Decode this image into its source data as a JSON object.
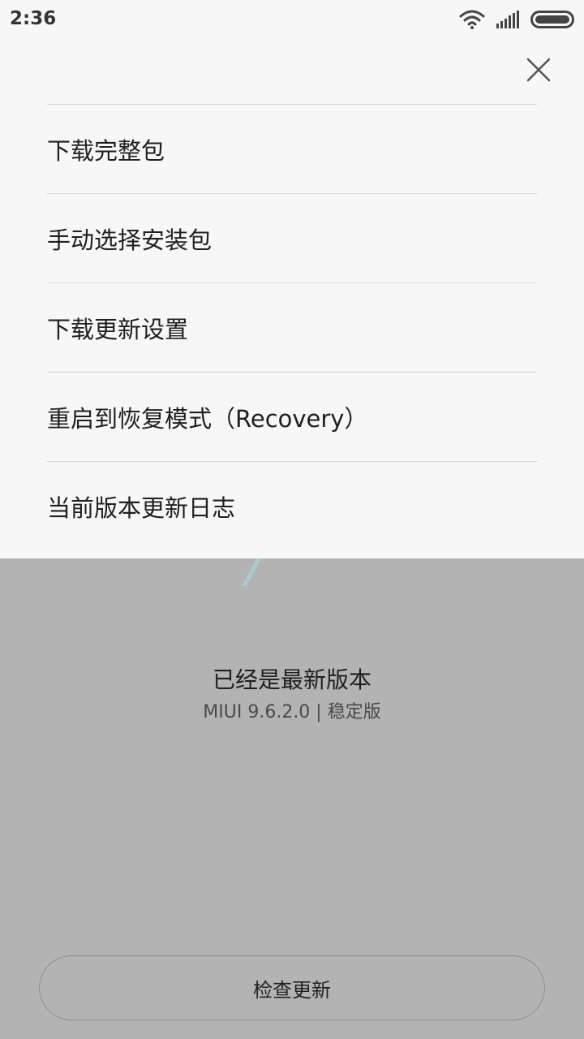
{
  "status_bar": {
    "time": "2:36",
    "icons": [
      "wifi-icon",
      "signal-icon",
      "battery-icon"
    ]
  },
  "menu": {
    "items": [
      {
        "label": "下载完整包"
      },
      {
        "label": "手动选择安装包"
      },
      {
        "label": "下载更新设置"
      },
      {
        "label": "重启到恢复模式（Recovery）"
      },
      {
        "label": "当前版本更新日志"
      }
    ],
    "close_icon": "close-icon"
  },
  "update_status": {
    "title": "已经是最新版本",
    "version": "MIUI 9.6.2.0 | 稳定版"
  },
  "check_button": {
    "label": "检查更新"
  },
  "colors": {
    "sheet_background": "#f7f7f7",
    "dim_background": "#b3b3b3",
    "divider": "#d9d9d9",
    "text_primary": "#1f1f1f"
  }
}
